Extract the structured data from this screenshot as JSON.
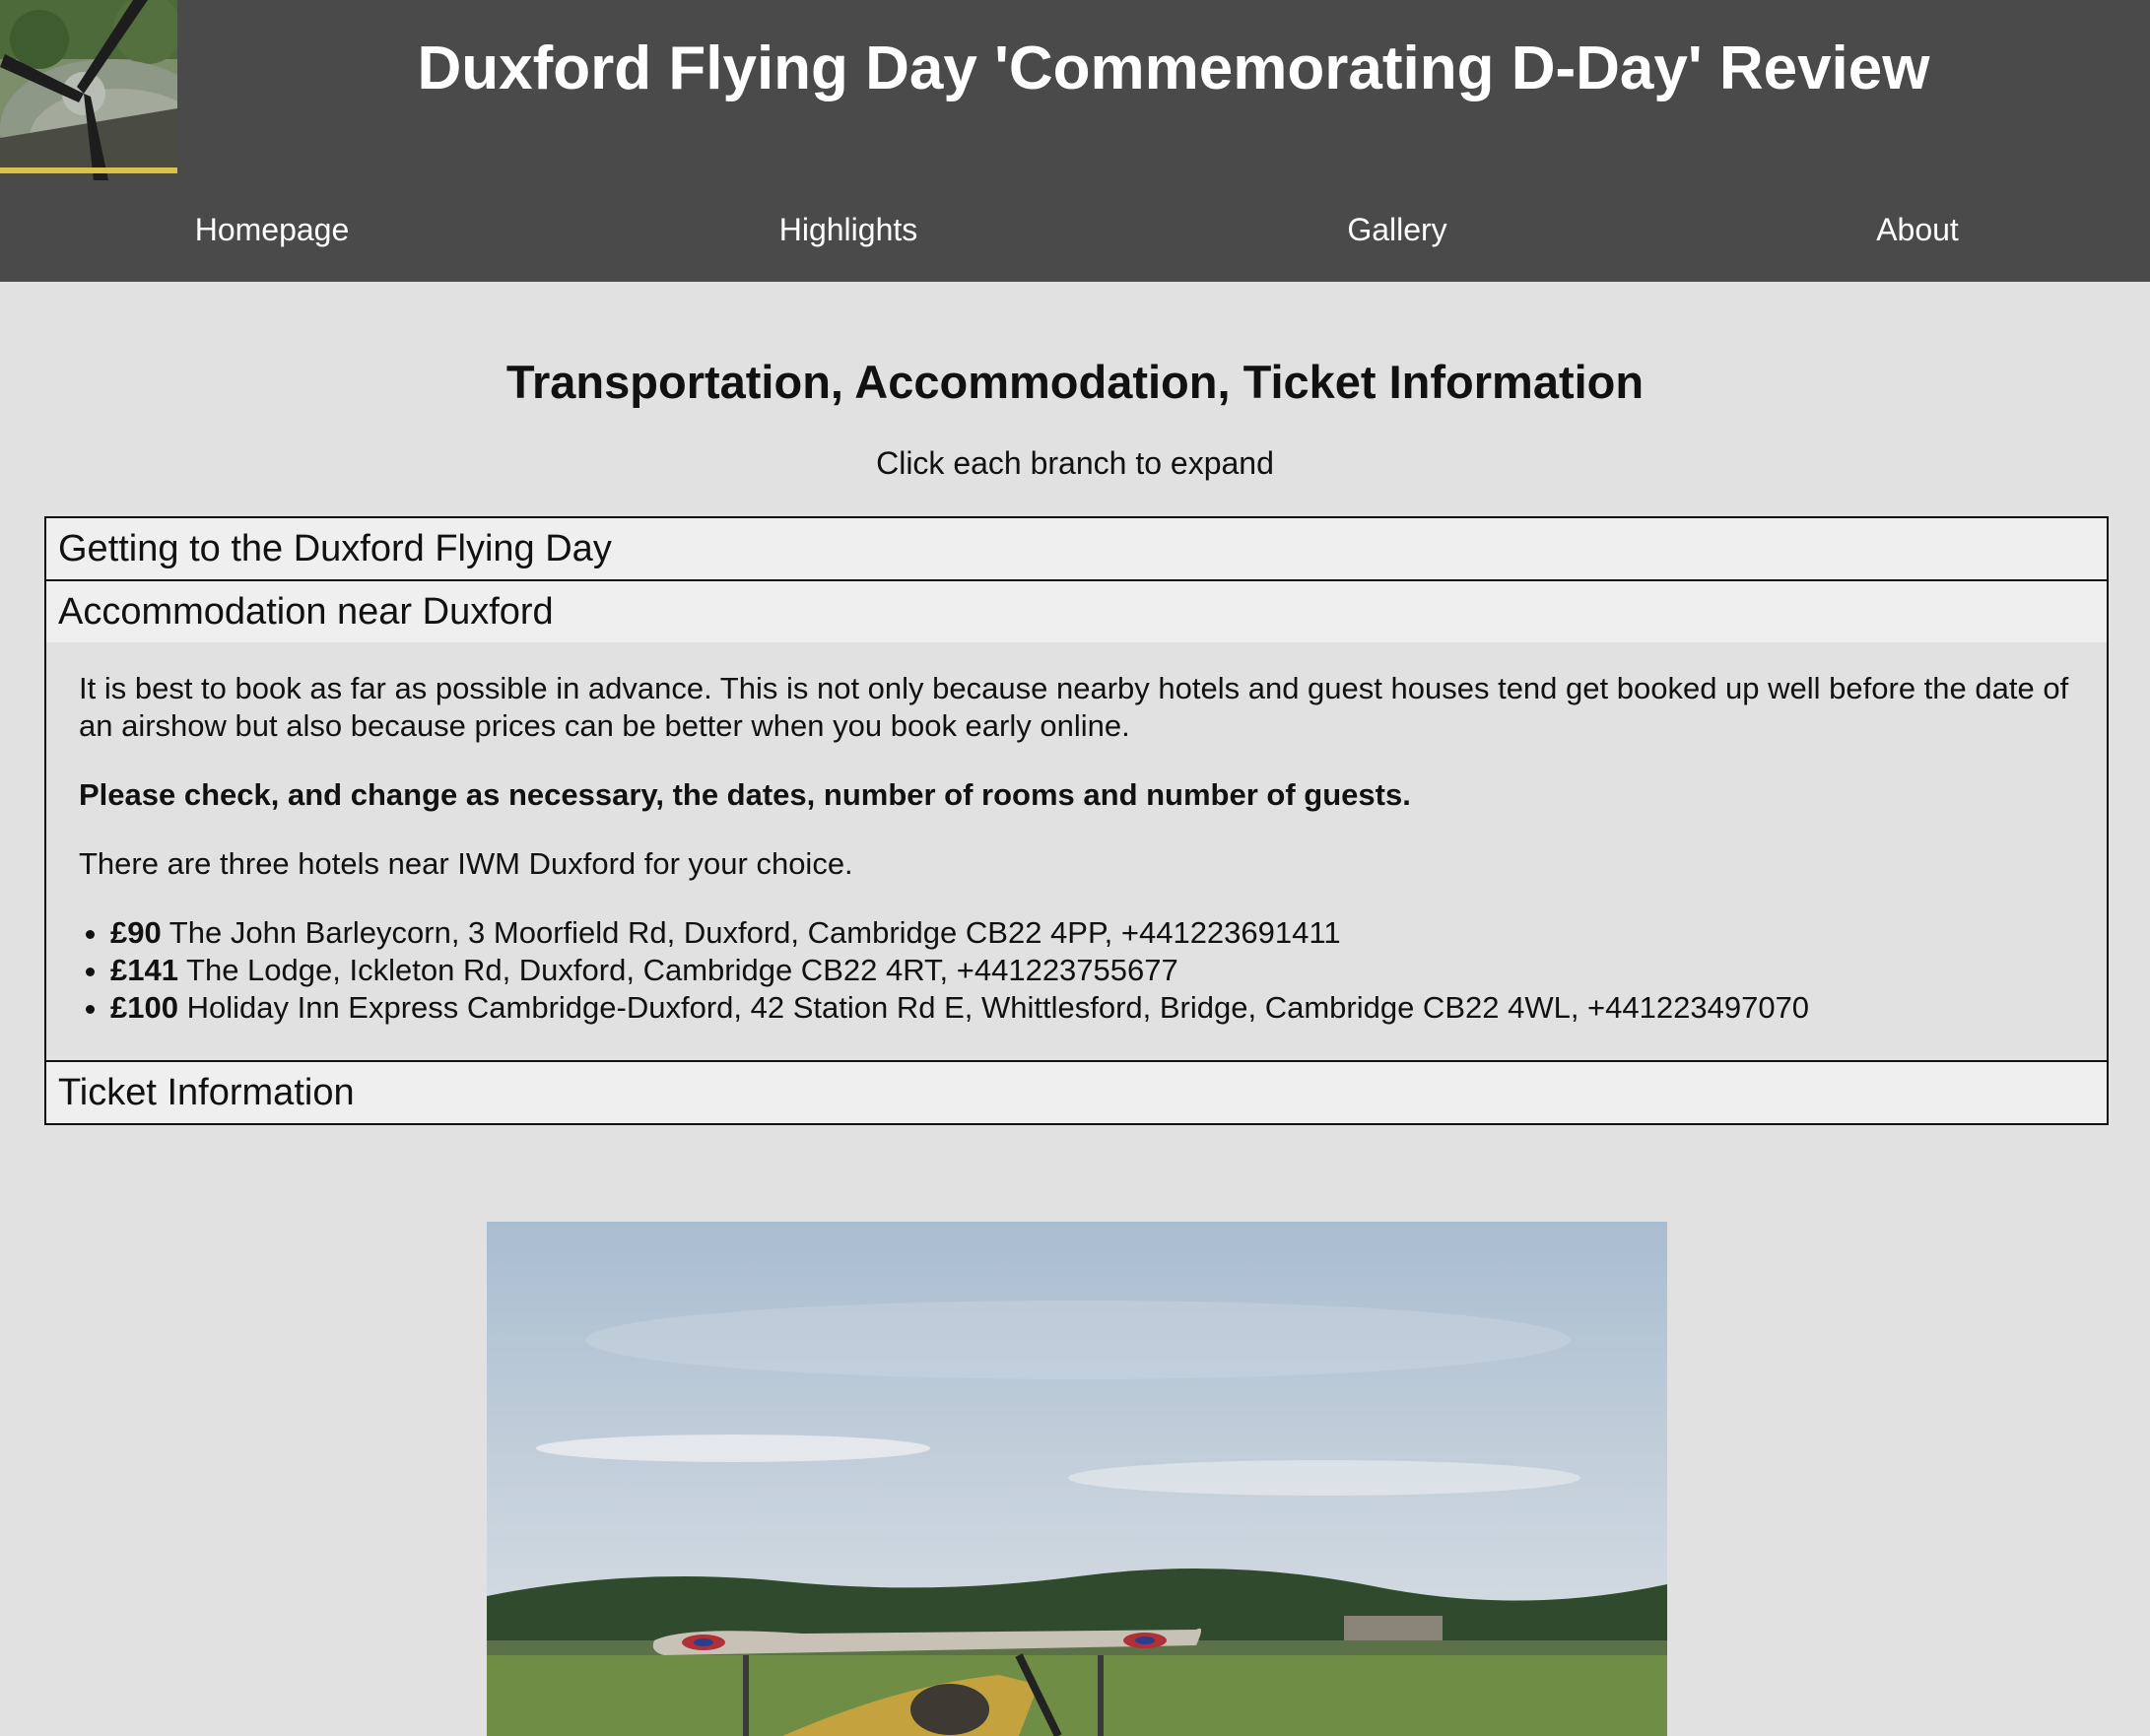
{
  "header": {
    "title": "Duxford Flying Day 'Commemorating D-Day' Review",
    "logo_icon": "spitfire-propeller-photo"
  },
  "nav": {
    "items": [
      {
        "label": "Homepage"
      },
      {
        "label": "Highlights"
      },
      {
        "label": "Gallery"
      },
      {
        "label": "About"
      }
    ]
  },
  "main": {
    "heading": "Transportation, Accommodation, Ticket Information",
    "instruction": "Click each branch to expand",
    "sections": [
      {
        "title": "Getting to the Duxford Flying Day"
      },
      {
        "title": "Accommodation near Duxford"
      },
      {
        "title": "Ticket Information"
      }
    ],
    "accommodation": {
      "intro": "It is best to book as far as possible in advance. This is not only because nearby hotels and guest houses tend get booked up well before the date of an airshow but also because prices can be better when you book early online.",
      "notice": "Please check, and change as necessary, the dates, number of rooms and number of guests.",
      "lead": "There are three hotels near IWM Duxford for your choice.",
      "hotels": [
        {
          "price": "£90",
          "details": "The John Barleycorn, 3 Moorfield Rd, Duxford, Cambridge CB22 4PP, +441223691411"
        },
        {
          "price": "£141",
          "details": "The Lodge, Ickleton Rd, Duxford, Cambridge CB22 4RT, +441223755677"
        },
        {
          "price": "£100",
          "details": "Holiday Inn Express Cambridge-Duxford, 42 Station Rd E, Whittlesford, Bridge, Cambridge CB22 4WL, +441223497070"
        }
      ]
    },
    "photo_icon": "tiger-moth-biplane-photo"
  },
  "colors": {
    "header_bg": "#4a4a4a",
    "page_bg": "#e0e1e0",
    "accordion_header_bg": "#efefef"
  }
}
